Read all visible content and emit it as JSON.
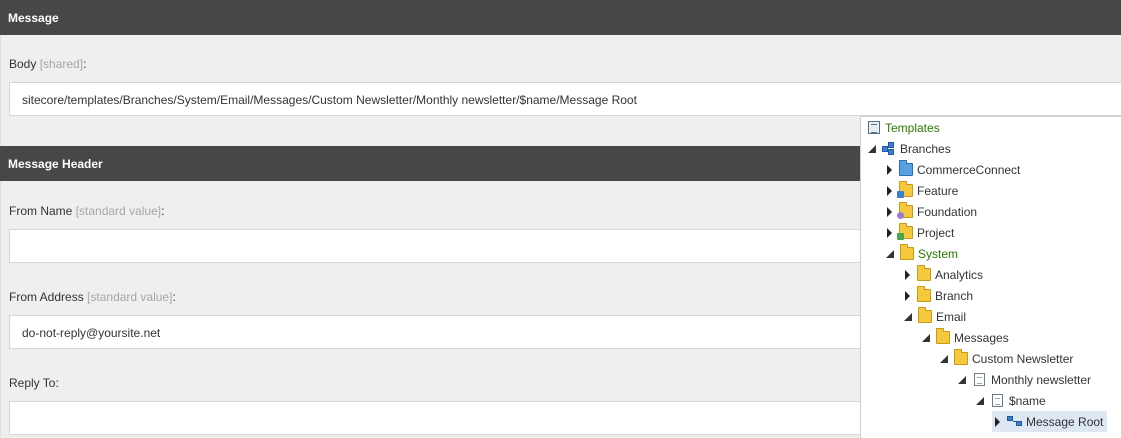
{
  "sections": {
    "message": {
      "title": "Message",
      "body_label": "Body",
      "body_note": "[shared]",
      "body_value": "sitecore/templates/Branches/System/Email/Messages/Custom Newsletter/Monthly newsletter/$name/Message Root"
    },
    "message_header": {
      "title": "Message Header",
      "from_name_label": "From Name",
      "from_name_note": "[standard value]",
      "from_name_value": "",
      "from_address_label": "From Address",
      "from_address_note": "[standard value]",
      "from_address_value": "do-not-reply@yoursite.net",
      "reply_to_label": "Reply To:",
      "reply_to_value": ""
    }
  },
  "colon": ":",
  "tree": {
    "items": [
      {
        "label": "Templates",
        "icon": "template-icon"
      },
      {
        "label": "Branches",
        "icon": "branch-icon"
      },
      {
        "label": "CommerceConnect",
        "icon": "folder-blue-icon"
      },
      {
        "label": "Feature",
        "icon": "folder-feature-icon"
      },
      {
        "label": "Foundation",
        "icon": "folder-foundation-icon"
      },
      {
        "label": "Project",
        "icon": "folder-project-icon"
      },
      {
        "label": "System",
        "icon": "folder-icon"
      },
      {
        "label": "Analytics",
        "icon": "folder-icon"
      },
      {
        "label": "Branch",
        "icon": "folder-icon"
      },
      {
        "label": "Email",
        "icon": "folder-icon"
      },
      {
        "label": "Messages",
        "icon": "folder-icon"
      },
      {
        "label": "Custom Newsletter",
        "icon": "folder-icon"
      },
      {
        "label": "Monthly newsletter",
        "icon": "document-icon"
      },
      {
        "label": "$name",
        "icon": "document-icon"
      },
      {
        "label": "Message Root",
        "icon": "node-icon"
      }
    ]
  },
  "colors": {
    "header_bg": "#474747",
    "panel_bg": "#efefef",
    "tree_active_text": "#2b7a00",
    "selection_bg": "#dde8f3"
  }
}
